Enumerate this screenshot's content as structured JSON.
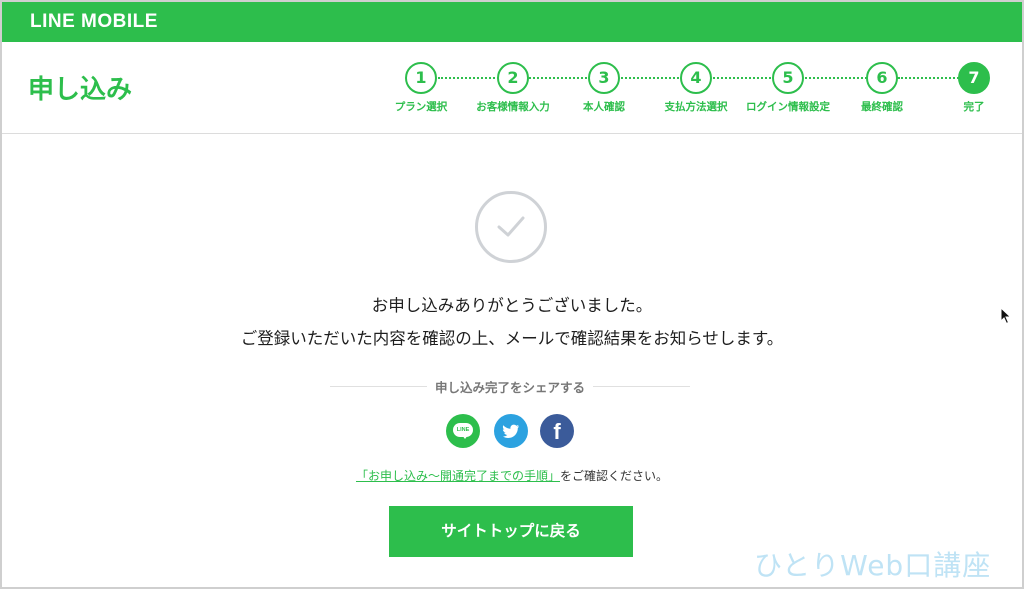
{
  "brand": "LINE MOBILE",
  "page_title": "申し込み",
  "steps": [
    {
      "number": "1",
      "label": "プラン選択"
    },
    {
      "number": "2",
      "label": "お客様情報入力"
    },
    {
      "number": "3",
      "label": "本人確認"
    },
    {
      "number": "4",
      "label": "支払方法選択"
    },
    {
      "number": "5",
      "label": "ログイン情報設定"
    },
    {
      "number": "6",
      "label": "最終確認"
    },
    {
      "number": "7",
      "label": "完了"
    }
  ],
  "current_step": 7,
  "messages": {
    "line1": "お申し込みありがとうございました。",
    "line2": "ご登録いただいた内容を確認の上、メールで確認結果をお知らせします。"
  },
  "share": {
    "label": "申し込み完了をシェアする",
    "line_icon_text": "LINE",
    "fb_glyph": "f"
  },
  "procedure": {
    "link_text": "「お申し込み〜開通完了までの手順」",
    "suffix": "をご確認ください。"
  },
  "cta_label": "サイトトップに戻る",
  "watermark": "ひとりWeb口講座",
  "colors": {
    "brand_green": "#2dbe4c",
    "twitter_blue": "#2ca2e0",
    "facebook_blue": "#3b5b9a",
    "check_gray": "#cfd2d6"
  },
  "icons": [
    "check-icon",
    "line-icon",
    "twitter-icon",
    "facebook-icon",
    "cursor-icon"
  ]
}
